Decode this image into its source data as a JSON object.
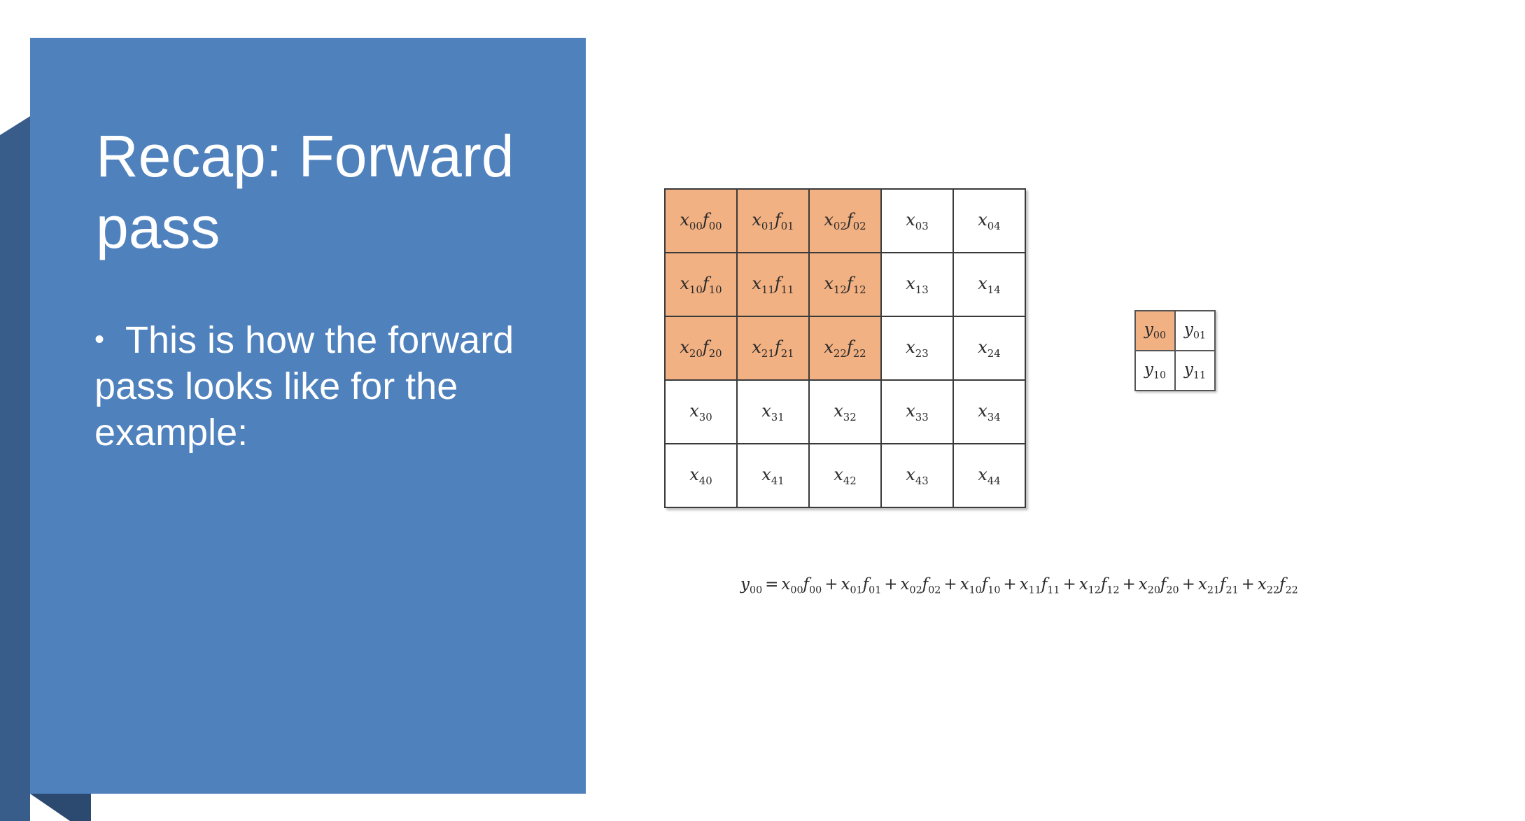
{
  "slide": {
    "title": "Recap: Forward pass",
    "bullets": [
      "This is how the forward pass looks like for the example:"
    ],
    "bullet_symbol": "•"
  },
  "diagram": {
    "colors": {
      "panel": "#4f81bd",
      "panel_shadow": "#385d8a",
      "highlight": "#f2b183",
      "cell_border": "#3a3a3a"
    },
    "input_grid": {
      "rows": [
        [
          {
            "x": "00",
            "f": "00",
            "highlight": true
          },
          {
            "x": "01",
            "f": "01",
            "highlight": true
          },
          {
            "x": "02",
            "f": "02",
            "highlight": true
          },
          {
            "x": "03",
            "f": "",
            "highlight": false
          },
          {
            "x": "04",
            "f": "",
            "highlight": false
          }
        ],
        [
          {
            "x": "10",
            "f": "10",
            "highlight": true
          },
          {
            "x": "11",
            "f": "11",
            "highlight": true
          },
          {
            "x": "12",
            "f": "12",
            "highlight": true
          },
          {
            "x": "13",
            "f": "",
            "highlight": false
          },
          {
            "x": "14",
            "f": "",
            "highlight": false
          }
        ],
        [
          {
            "x": "20",
            "f": "20",
            "highlight": true
          },
          {
            "x": "21",
            "f": "21",
            "highlight": true
          },
          {
            "x": "22",
            "f": "22",
            "highlight": true
          },
          {
            "x": "23",
            "f": "",
            "highlight": false
          },
          {
            "x": "24",
            "f": "",
            "highlight": false
          }
        ],
        [
          {
            "x": "30",
            "f": "",
            "highlight": false
          },
          {
            "x": "31",
            "f": "",
            "highlight": false
          },
          {
            "x": "32",
            "f": "",
            "highlight": false
          },
          {
            "x": "33",
            "f": "",
            "highlight": false
          },
          {
            "x": "34",
            "f": "",
            "highlight": false
          }
        ],
        [
          {
            "x": "40",
            "f": "",
            "highlight": false
          },
          {
            "x": "41",
            "f": "",
            "highlight": false
          },
          {
            "x": "42",
            "f": "",
            "highlight": false
          },
          {
            "x": "43",
            "f": "",
            "highlight": false
          },
          {
            "x": "44",
            "f": "",
            "highlight": false
          }
        ]
      ]
    },
    "output_grid": {
      "cells": [
        {
          "y": "00",
          "highlight": true
        },
        {
          "y": "01",
          "highlight": false
        },
        {
          "y": "10",
          "highlight": false
        },
        {
          "y": "11",
          "highlight": false
        }
      ]
    },
    "equation": {
      "lhs": "00",
      "equals": "=",
      "plus": "+",
      "terms": [
        "00",
        "01",
        "02",
        "10",
        "11",
        "12",
        "20",
        "21",
        "22"
      ]
    }
  }
}
